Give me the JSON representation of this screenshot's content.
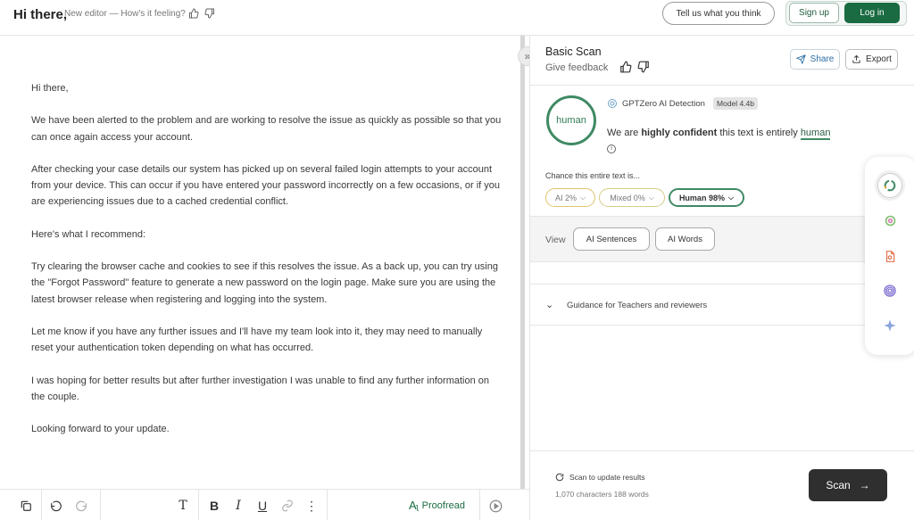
{
  "header": {
    "doc_title": "Hi there,",
    "feedback_prompt": "New editor — How's it feeling?",
    "tell_us_label": "Tell us what you think",
    "signup_label": "Sign up",
    "login_label": "Log in"
  },
  "editor": {
    "paragraphs": [
      "Hi there,",
      "We have been alerted to the problem and are working to resolve the issue as quickly as possible so that you can once again access your account.",
      "After checking your case details our system has picked up on several failed login attempts to your account from your device. This can occur if you have entered your password incorrectly on a few occasions, or if you are experiencing issues due to a cached credential conflict.",
      "Here's what I recommend:",
      "Try clearing the browser cache and cookies to see if this resolves the issue. As a back up, you can try using the \"Forgot Password\" feature to generate a new password on the login page. Make sure you are using the latest browser release when registering and logging into the system.",
      "Let me know if you have any further issues and I'll have my team look into it, they may need to manually reset your authentication token depending on what has occurred.",
      "I was hoping for better results but after further investigation I was unable to find any further information on the couple.",
      "Looking forward to your update."
    ]
  },
  "toolbar": {
    "proofread_label": "Proofread"
  },
  "panel": {
    "title": "Basic Scan",
    "give_feedback": "Give feedback",
    "share_label": "Share",
    "export_label": "Export",
    "result_ring_label": "human",
    "detector_name": "GPTZero AI Detection",
    "model_badge": "Model 4.4b",
    "confidence_prefix": "We are ",
    "confidence_strong": "highly confident",
    "confidence_middle": " this text is entirely ",
    "confidence_result": "human",
    "chance_label": "Chance this entire text is...",
    "pills": {
      "ai": "AI 2%",
      "mixed": "Mixed 0%",
      "human": "Human 98%"
    },
    "view_label": "View",
    "ai_sentences_label": "AI Sentences",
    "ai_words_label": "AI Words",
    "guidance_label": "Guidance for Teachers and reviewers",
    "scan_update_label": "Scan to update results",
    "char_count": "1,070 characters 188 words",
    "scan_button_label": "Scan"
  },
  "colors": {
    "brand_green": "#1a6b42",
    "human_green": "#3f8a64",
    "ai_yellow": "#e0c36b",
    "scan_button": "#2f2f2f"
  },
  "icons": {
    "sidebar": [
      "gptzero-ring-icon",
      "ai-vs-human-icon",
      "plagiarism-doc-icon",
      "spiral-icon",
      "sparkle-icon"
    ]
  }
}
